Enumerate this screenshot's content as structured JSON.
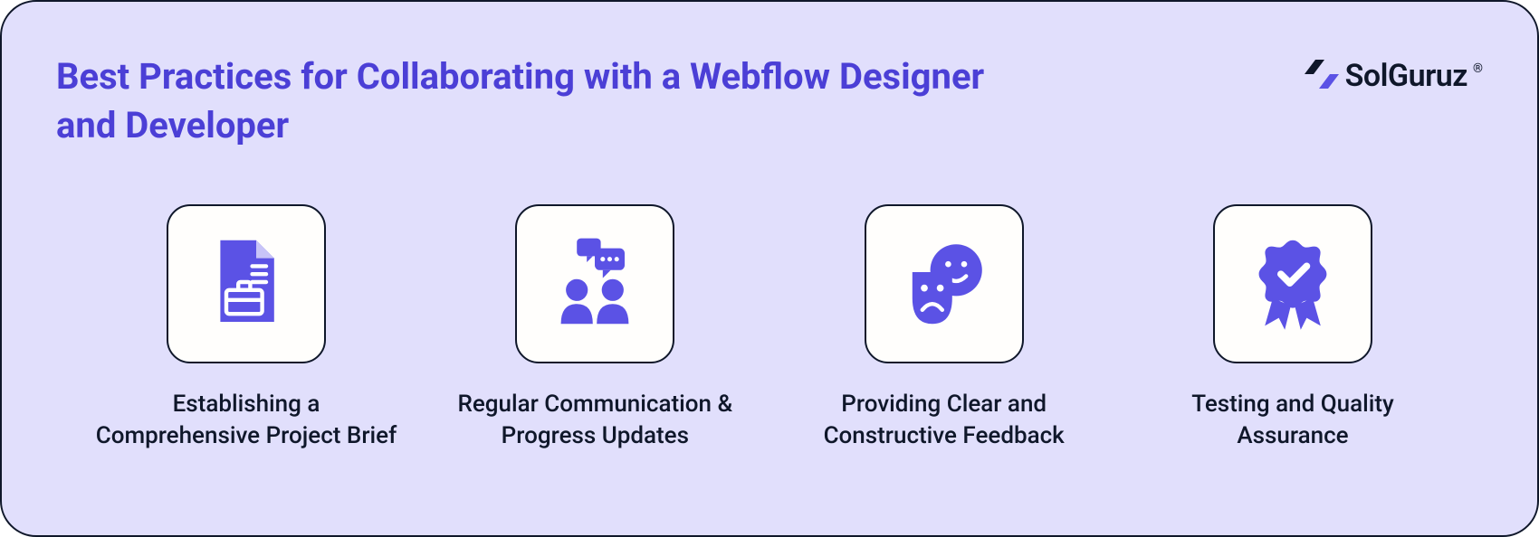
{
  "title": "Best Practices for Collaborating with a Webflow Designer and Developer",
  "brand": {
    "name": "SolGuruz",
    "registered": "®"
  },
  "items": [
    {
      "icon": "brief-document-icon",
      "caption": "Establishing a Comprehensive Project Brief"
    },
    {
      "icon": "people-chat-icon",
      "caption": "Regular Communication & Progress Updates"
    },
    {
      "icon": "feedback-faces-icon",
      "caption": "Providing Clear and Constructive Feedback"
    },
    {
      "icon": "ribbon-check-icon",
      "caption": "Testing and Quality Assurance"
    }
  ],
  "colors": {
    "accent": "#5B52E5",
    "title": "#4B3FD6",
    "bg": "#E1DFFC",
    "tile": "#FFFEFC",
    "stroke": "#0F172A"
  }
}
